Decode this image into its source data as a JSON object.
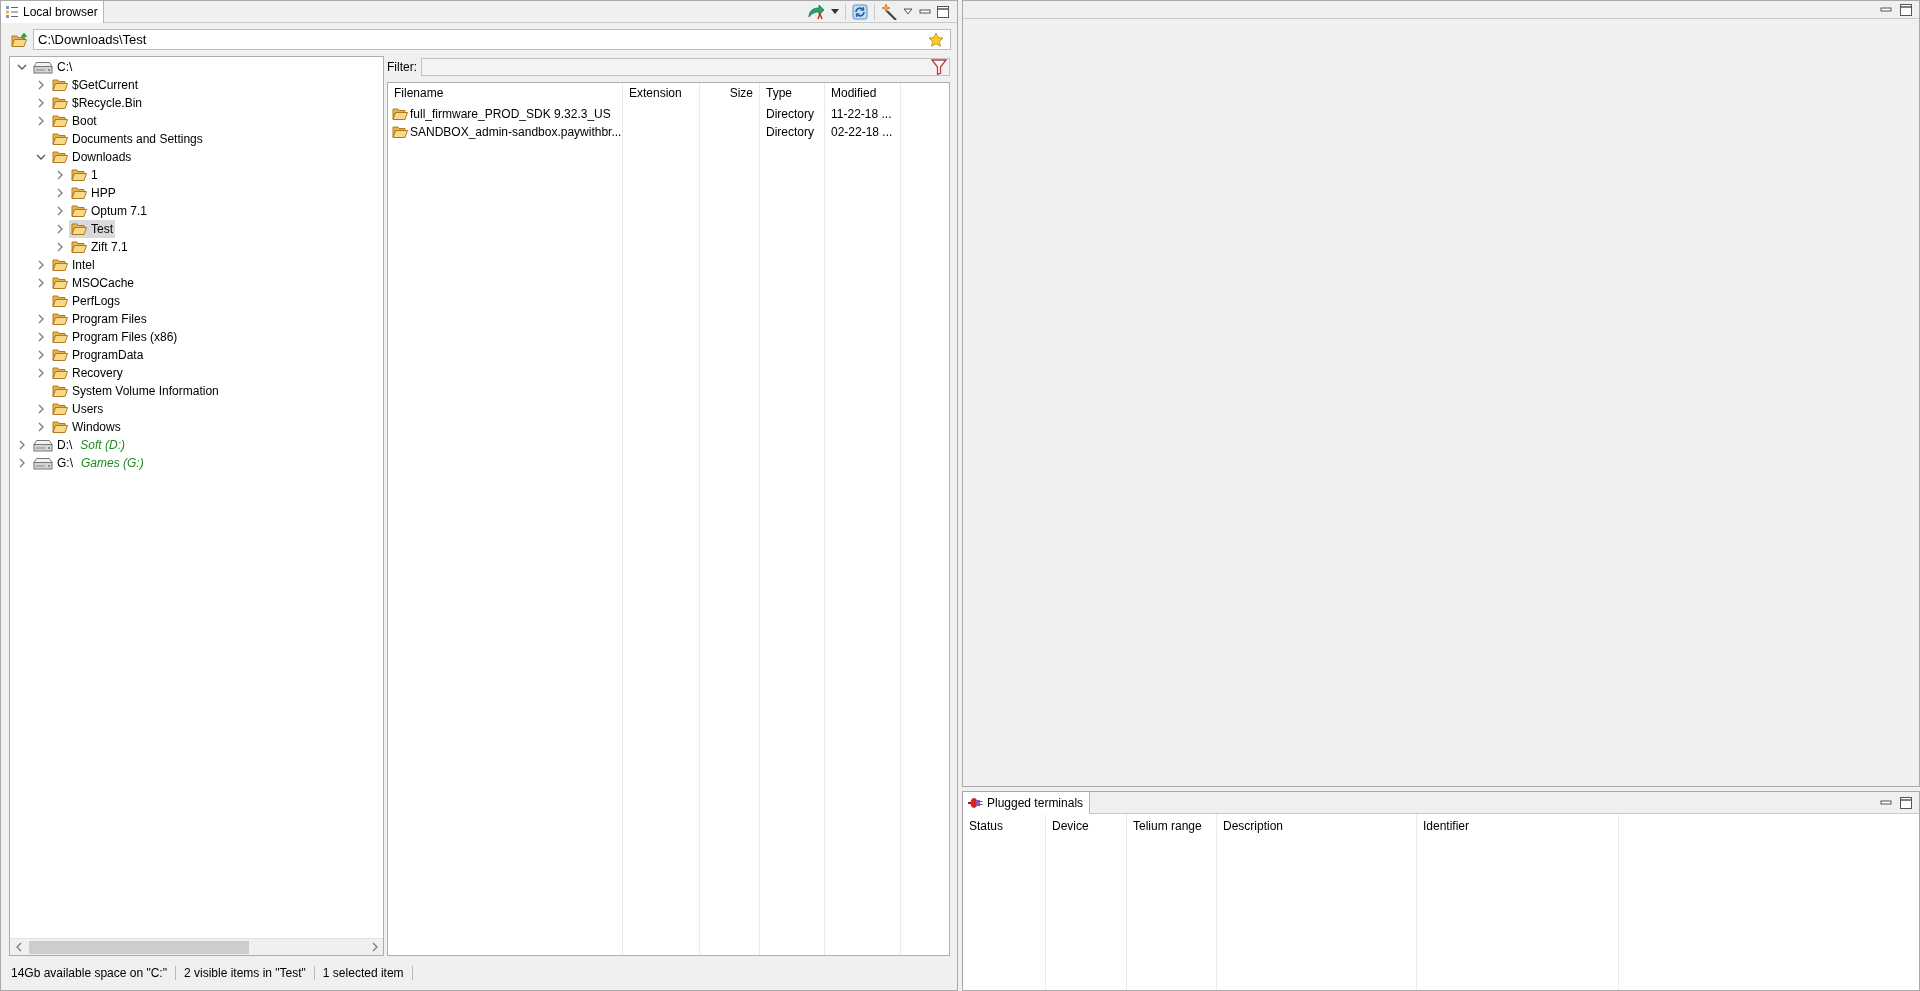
{
  "left_view": {
    "tab": {
      "label": "Local browser",
      "selected": true
    },
    "path": "C:\\Downloads\\Test",
    "tree": [
      {
        "kind": "drive",
        "label": "C:\\",
        "expandable": true,
        "expanded": true,
        "selected": false,
        "children": [
          {
            "kind": "folder",
            "label": "$GetCurrent",
            "expandable": true,
            "expanded": false,
            "selected": false
          },
          {
            "kind": "folder",
            "label": "$Recycle.Bin",
            "expandable": true,
            "expanded": false,
            "selected": false
          },
          {
            "kind": "folder",
            "label": "Boot",
            "expandable": true,
            "expanded": false,
            "selected": false
          },
          {
            "kind": "folder",
            "label": "Documents and Settings",
            "expandable": false,
            "expanded": false,
            "selected": false
          },
          {
            "kind": "folder",
            "label": "Downloads",
            "expandable": true,
            "expanded": true,
            "selected": false,
            "children": [
              {
                "kind": "folder",
                "label": "1",
                "expandable": true,
                "expanded": false,
                "selected": false
              },
              {
                "kind": "folder",
                "label": "HPP",
                "expandable": true,
                "expanded": false,
                "selected": false
              },
              {
                "kind": "folder",
                "label": "Optum 7.1",
                "expandable": true,
                "expanded": false,
                "selected": false
              },
              {
                "kind": "folder",
                "label": "Test",
                "expandable": true,
                "expanded": false,
                "selected": true
              },
              {
                "kind": "folder",
                "label": "Zift 7.1",
                "expandable": true,
                "expanded": false,
                "selected": false
              }
            ]
          },
          {
            "kind": "folder",
            "label": "Intel",
            "expandable": true,
            "expanded": false,
            "selected": false
          },
          {
            "kind": "folder",
            "label": "MSOCache",
            "expandable": true,
            "expanded": false,
            "selected": false
          },
          {
            "kind": "folder",
            "label": "PerfLogs",
            "expandable": false,
            "expanded": false,
            "selected": false
          },
          {
            "kind": "folder",
            "label": "Program Files",
            "expandable": true,
            "expanded": false,
            "selected": false
          },
          {
            "kind": "folder",
            "label": "Program Files (x86)",
            "expandable": true,
            "expanded": false,
            "selected": false
          },
          {
            "kind": "folder",
            "label": "ProgramData",
            "expandable": true,
            "expanded": false,
            "selected": false
          },
          {
            "kind": "folder",
            "label": "Recovery",
            "expandable": true,
            "expanded": false,
            "selected": false
          },
          {
            "kind": "folder",
            "label": "System Volume Information",
            "expandable": false,
            "expanded": false,
            "selected": false
          },
          {
            "kind": "folder",
            "label": "Users",
            "expandable": true,
            "expanded": false,
            "selected": false
          },
          {
            "kind": "folder",
            "label": "Windows",
            "expandable": true,
            "expanded": false,
            "selected": false
          }
        ]
      },
      {
        "kind": "drive",
        "label": "D:\\",
        "volume": "Soft (D:)",
        "expandable": true,
        "expanded": false,
        "selected": false
      },
      {
        "kind": "drive",
        "label": "G:\\",
        "volume": "Games (G:)",
        "expandable": true,
        "expanded": false,
        "selected": false
      }
    ],
    "filter_label": "Filter:",
    "files": {
      "columns": [
        "Filename",
        "Extension",
        "Size",
        "Type",
        "Modified"
      ],
      "rows": [
        {
          "filename": "full_firmware_PROD_SDK 9.32.3_US",
          "type": "Directory",
          "modified": "11-22-18 ..."
        },
        {
          "filename": "SANDBOX_admin-sandbox.paywithbr...",
          "type": "Directory",
          "modified": "02-22-18 ..."
        }
      ]
    },
    "status_bar": [
      "14Gb available space on \"C:\"",
      "2 visible items in \"Test\"",
      "1 selected item"
    ]
  },
  "terminals_view": {
    "tab": {
      "label": "Plugged terminals",
      "selected": true
    },
    "columns": [
      "Status",
      "Device",
      "Telium range",
      "Description",
      "Identifier"
    ]
  }
}
